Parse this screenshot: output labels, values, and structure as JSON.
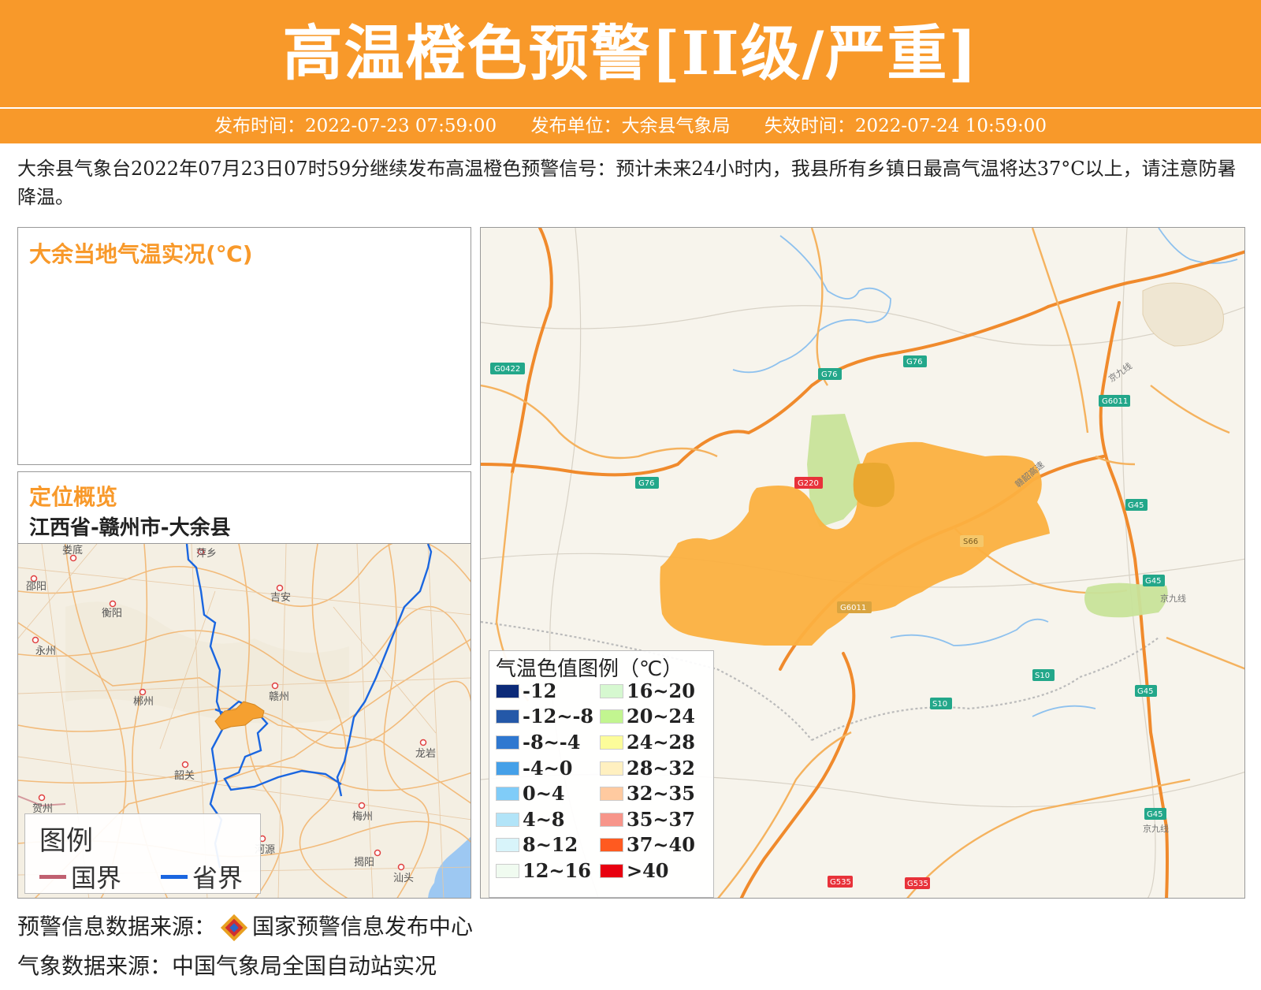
{
  "header": {
    "title": "高温橙色预警[II级/严重]"
  },
  "subbar": {
    "issue_time": "发布时间：2022-07-23 07:59:00",
    "issuer": "发布单位：大余县气象局",
    "expire_time": "失效时间：2022-07-24 10:59:00"
  },
  "description": "大余县气象台2022年07月23日07时59分继续发布高温橙色预警信号：预计未来24小时内，我县所有乡镇日最高气温将达37°C以上，请注意防暑降温。",
  "live_panel": {
    "title": "大余当地气温实况(℃)"
  },
  "location_panel": {
    "title": "定位概览",
    "path": "江西省-赣州市-大余县"
  },
  "overview_map": {
    "cities": [
      "娄底",
      "萍乡",
      "邵阳",
      "衡阳",
      "吉安",
      "永州",
      "郴州",
      "赣州",
      "韶关",
      "龙岩",
      "梅州",
      "贺州",
      "河源",
      "揭阳",
      "汕头"
    ],
    "legend": {
      "title": "图例",
      "national_border": "国界",
      "provincial_border": "省界"
    },
    "colors": {
      "national_border": "#c06070",
      "provincial_border": "#1a66e0",
      "highlight": "#f5a030"
    }
  },
  "main_map": {
    "road_labels": [
      "G0422",
      "G76",
      "G76",
      "G76",
      "G220",
      "S66",
      "G6011",
      "G6011",
      "G45",
      "G45",
      "G45",
      "G45",
      "S10",
      "S10",
      "G535",
      "G535",
      "京九线",
      "京九线",
      "京九线",
      "赣韶高速"
    ],
    "colors": {
      "warning_area": "#fbb040",
      "overlap": "#eaa830",
      "green_area": "#c8e39a"
    }
  },
  "temp_legend": {
    "title": "气温色值图例（℃）",
    "items": [
      {
        "label": "-12",
        "color": "#0c2a78"
      },
      {
        "label": "-12~-8",
        "color": "#2458a8"
      },
      {
        "label": "-8~-4",
        "color": "#2f78d0"
      },
      {
        "label": "-4~0",
        "color": "#45a0e8"
      },
      {
        "label": "0~4",
        "color": "#80ccf8"
      },
      {
        "label": "4~8",
        "color": "#b2e4f8"
      },
      {
        "label": "8~12",
        "color": "#d8f4fa"
      },
      {
        "label": "12~16",
        "color": "#f0fbf0"
      },
      {
        "label": "16~20",
        "color": "#d6f8d0"
      },
      {
        "label": "20~24",
        "color": "#c2f590"
      },
      {
        "label": "24~28",
        "color": "#fcfc9a"
      },
      {
        "label": "28~32",
        "color": "#fff0c0"
      },
      {
        "label": "32~35",
        "color": "#ffcaa0"
      },
      {
        "label": "35~37",
        "color": "#f7958a"
      },
      {
        "label": "37~40",
        "color": "#ff5a20"
      },
      {
        "label": ">40",
        "color": "#e80010"
      }
    ]
  },
  "footer": {
    "warning_source": "预警信息数据来源：",
    "warning_source_name": "国家预警信息发布中心",
    "weather_source": "气象数据来源：中国气象局全国自动站实况"
  }
}
